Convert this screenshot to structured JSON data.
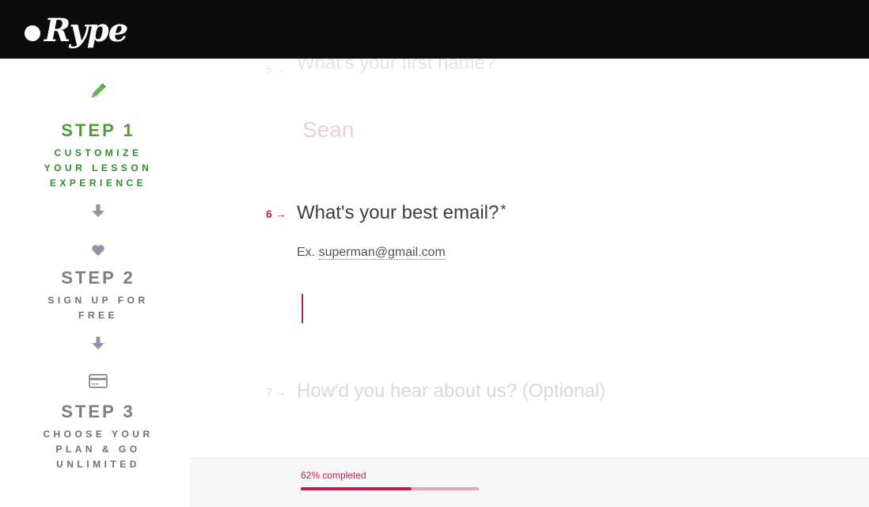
{
  "header": {
    "logo_text": "Rype"
  },
  "sidebar": {
    "steps": [
      {
        "title": "STEP 1",
        "subtitle_lines": [
          "CUSTOMIZE",
          "YOUR LESSON",
          "EXPERIENCE"
        ],
        "icon": "pencil-icon",
        "state": "active"
      },
      {
        "title": "STEP 2",
        "subtitle_lines": [
          "SIGN UP FOR",
          "FREE"
        ],
        "icon": "heart-icon",
        "state": "inactive"
      },
      {
        "title": "STEP 3",
        "subtitle_lines": [
          "CHOOSE YOUR",
          "PLAN & GO",
          "UNLIMITED"
        ],
        "icon": "credit-card-icon",
        "state": "inactive"
      }
    ]
  },
  "form": {
    "q5": {
      "number": "5",
      "arrow": "→",
      "text": "What's your first name?",
      "answer": "Sean"
    },
    "q6": {
      "number": "6",
      "arrow": "→",
      "text": "What's your best email?",
      "required_mark": "*",
      "hint_prefix": "Ex.",
      "hint_example": "superman@gmail.com",
      "value": ""
    },
    "q7": {
      "number": "7",
      "arrow": "→",
      "text": "How'd you hear about us? (Optional)"
    }
  },
  "progress": {
    "label": "62% completed",
    "percent": 62
  },
  "colors": {
    "accent": "#b6224d",
    "step_active": "#4f9b3c",
    "step_inactive": "#7d7d7d",
    "header_bg": "#0c0c0c"
  }
}
